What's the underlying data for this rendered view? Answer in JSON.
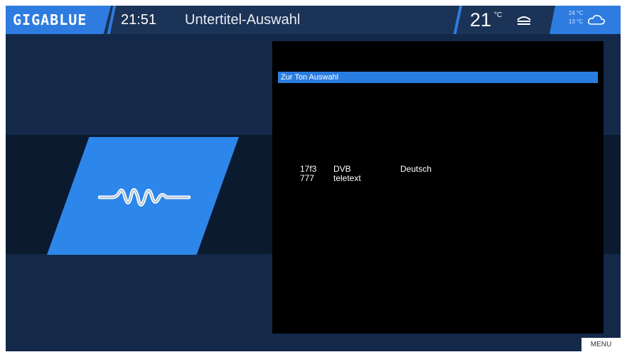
{
  "header": {
    "logo": "GIGABLUE",
    "time": "21:51",
    "title": "Untertitel-Auswahl",
    "temperature": "21",
    "temperature_unit": "°C",
    "weather_high": "24 °C",
    "weather_low": "13 °C"
  },
  "icons": {
    "device": "box-icon",
    "weather": "cloud-icon",
    "wave": "audio-wave-icon"
  },
  "panel": {
    "title": "Zur Ton Auswahl",
    "rows": [
      {
        "id": "17f3",
        "type": "DVB",
        "language": "Deutsch"
      },
      {
        "id": "777",
        "type": "teletext",
        "language": ""
      }
    ]
  },
  "footer": {
    "menu_label": "MENU"
  },
  "colors": {
    "accent": "#2e7ce0",
    "background": "#14294a",
    "panel": "#000000"
  }
}
